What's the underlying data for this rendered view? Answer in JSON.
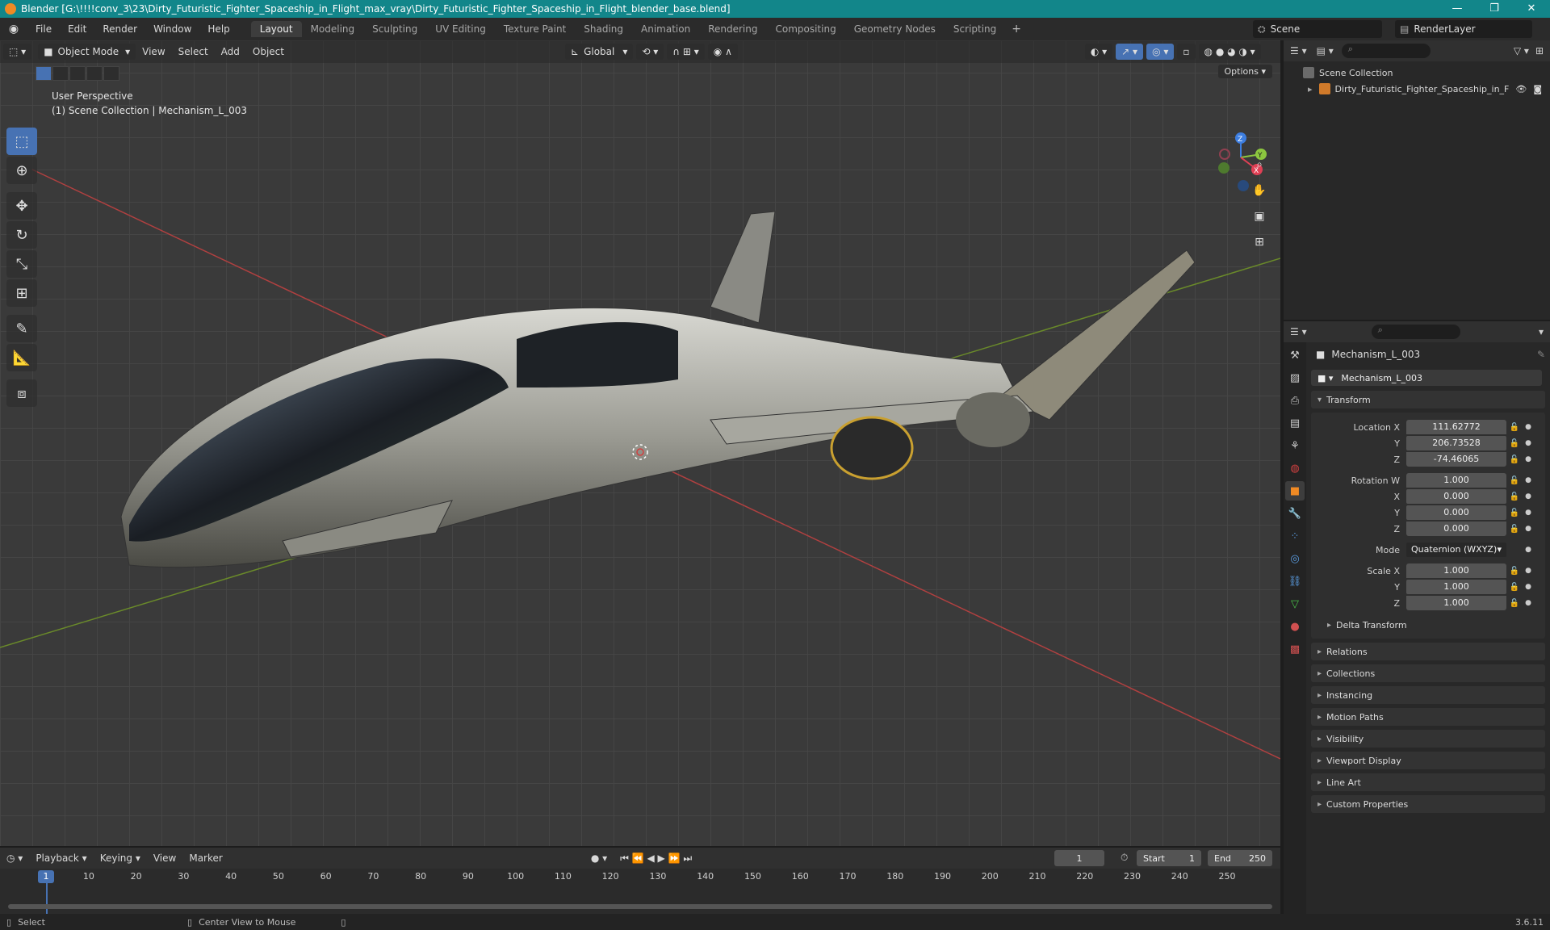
{
  "window": {
    "title": "Blender [G:\\!!!!conv_3\\23\\Dirty_Futuristic_Fighter_Spaceship_in_Flight_max_vray\\Dirty_Futuristic_Fighter_Spaceship_in_Flight_blender_base.blend]",
    "controls": [
      "—",
      "❐",
      "✕"
    ]
  },
  "menu": {
    "items": [
      "File",
      "Edit",
      "Render",
      "Window",
      "Help"
    ],
    "workspaces": [
      "Layout",
      "Modeling",
      "Sculpting",
      "UV Editing",
      "Texture Paint",
      "Shading",
      "Animation",
      "Rendering",
      "Compositing",
      "Geometry Nodes",
      "Scripting"
    ],
    "active_workspace": "Layout",
    "scene": "Scene",
    "view_layer": "RenderLayer"
  },
  "viewport": {
    "mode": "Object Mode",
    "menus": [
      "View",
      "Select",
      "Add",
      "Object"
    ],
    "orientation": "Global",
    "options": "Options",
    "perspective": "User Perspective",
    "context": "(1) Scene Collection | Mechanism_L_003",
    "gizmo": {
      "x": "X",
      "y": "Y",
      "z": "Z"
    }
  },
  "outliner": {
    "root": "Scene Collection",
    "object": "Dirty_Futuristic_Fighter_Spaceship_in_F"
  },
  "properties": {
    "object_name": "Mechanism_L_003",
    "data_name": "Mechanism_L_003",
    "transform_label": "Transform",
    "location": {
      "label": "Location X",
      "x": "111.62772",
      "y": "206.73528",
      "z": "-74.46065"
    },
    "rotation": {
      "label": "Rotation W",
      "w": "1.000",
      "x": "0.000",
      "y": "0.000",
      "z": "0.000"
    },
    "mode": {
      "label": "Mode",
      "value": "Quaternion (WXYZ)"
    },
    "scale": {
      "label": "Scale X",
      "x": "1.000",
      "y": "1.000",
      "z": "1.000"
    },
    "axis": {
      "y": "Y",
      "z": "Z",
      "x": "X"
    },
    "delta": "Delta Transform",
    "panels": [
      "Relations",
      "Collections",
      "Instancing",
      "Motion Paths",
      "Visibility",
      "Viewport Display",
      "Line Art",
      "Custom Properties"
    ]
  },
  "timeline": {
    "menus": [
      "Playback",
      "Keying",
      "View",
      "Marker"
    ],
    "current_frame": "1",
    "start_label": "Start",
    "start": "1",
    "end_label": "End",
    "end": "250",
    "ticks": [
      "1",
      "10",
      "20",
      "30",
      "40",
      "50",
      "60",
      "70",
      "80",
      "90",
      "100",
      "110",
      "120",
      "130",
      "140",
      "150",
      "160",
      "170",
      "180",
      "190",
      "200",
      "210",
      "220",
      "230",
      "240",
      "250"
    ]
  },
  "status": {
    "select": "Select",
    "center": "Center View to Mouse",
    "version": "3.6.11"
  }
}
